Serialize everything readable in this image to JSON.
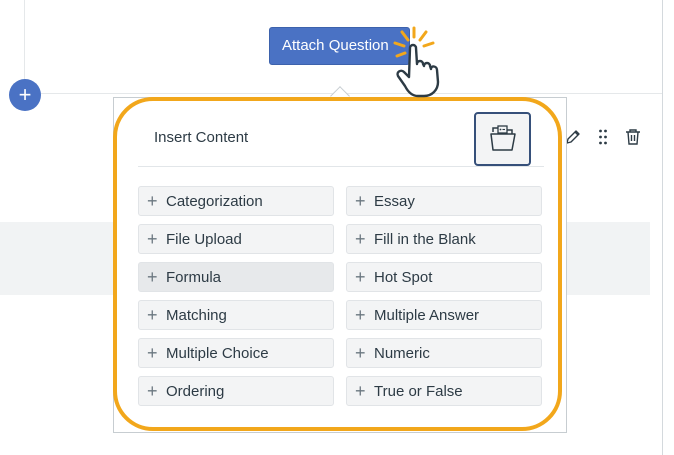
{
  "attach_button": {
    "label": "Attach Question"
  },
  "add_button": {
    "glyph": "+"
  },
  "popup": {
    "title": "Insert Content",
    "options_left": [
      {
        "label": "Categorization"
      },
      {
        "label": "File Upload"
      },
      {
        "label": "Formula"
      },
      {
        "label": "Matching"
      },
      {
        "label": "Multiple Choice"
      },
      {
        "label": "Ordering"
      }
    ],
    "options_right": [
      {
        "label": "Essay"
      },
      {
        "label": "Fill in the Blank"
      },
      {
        "label": "Hot Spot"
      },
      {
        "label": "Multiple Answer"
      },
      {
        "label": "Numeric"
      },
      {
        "label": "True or False"
      }
    ],
    "plus_glyph": "+"
  },
  "icons": {
    "folder": "folder-open-icon",
    "edit": "pencil-icon",
    "drag": "drag-handle-icon",
    "delete": "trash-icon",
    "cursor": "hand-pointer-icon"
  },
  "colors": {
    "primary": "#4a72c4",
    "highlight": "#f2a71b",
    "option_bg": "#f3f4f5",
    "text": "#2d3b45"
  }
}
